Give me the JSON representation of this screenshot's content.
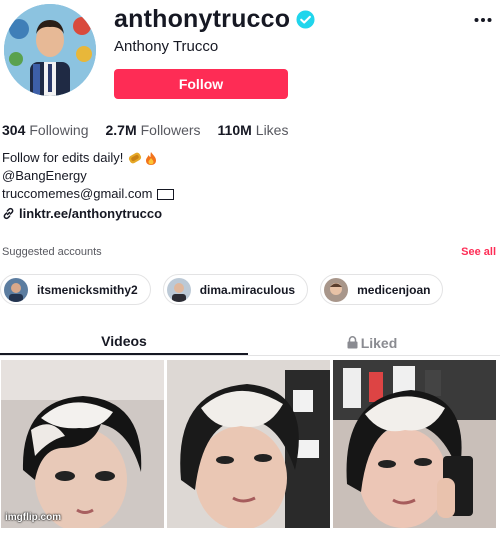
{
  "profile": {
    "username": "anthonytrucco",
    "display_name": "Anthony Trucco",
    "follow_label": "Follow",
    "more_icon": "more-icon",
    "verified_icon": "verified-icon"
  },
  "stats": [
    {
      "value": "304",
      "label": "Following"
    },
    {
      "value": "2.7M",
      "label": "Followers"
    },
    {
      "value": "110M",
      "label": "Likes"
    }
  ],
  "bio": {
    "line1": "Follow for edits daily!",
    "line2": "@BangEnergy",
    "line3": "truccomemes@gmail.com",
    "link": "linktr.ee/anthonytrucco"
  },
  "suggested": {
    "title": "Suggested accounts",
    "see_all": "See all",
    "accounts": [
      {
        "name": "itsmenicksmithy2"
      },
      {
        "name": "dima.miraculous"
      },
      {
        "name": "medicenjoan"
      }
    ]
  },
  "tabs": {
    "videos": "Videos",
    "liked": "Liked"
  },
  "watermark": "imgflip.com",
  "colors": {
    "accent": "#fe2c55",
    "verified": "#20d5ec"
  }
}
